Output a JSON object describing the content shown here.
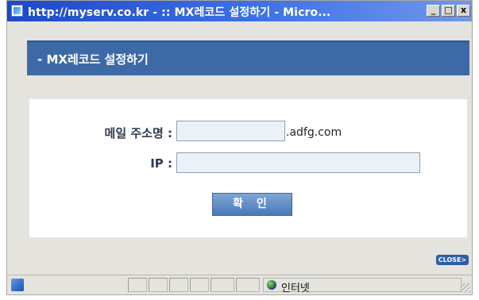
{
  "window": {
    "title": "http://myserv.co.kr - :: MX레코드 설정하기 - Micro...",
    "minimize_glyph": "_",
    "maximize_glyph": "□",
    "close_glyph": "x"
  },
  "page": {
    "header_title": "- MX레코드 설정하기",
    "form": {
      "email_label": "메일 주소명 :",
      "email_value": "",
      "domain_suffix": ".adfg.com",
      "ip_label": "IP :",
      "ip_value": "",
      "confirm_label": "확 인"
    },
    "close_label": "CLOSE>"
  },
  "statusbar": {
    "zone_text": "인터넷"
  },
  "colors": {
    "titlebar": "#2a5bd7",
    "header_bar": "#3d6aa7",
    "button": "#5a86c2"
  }
}
